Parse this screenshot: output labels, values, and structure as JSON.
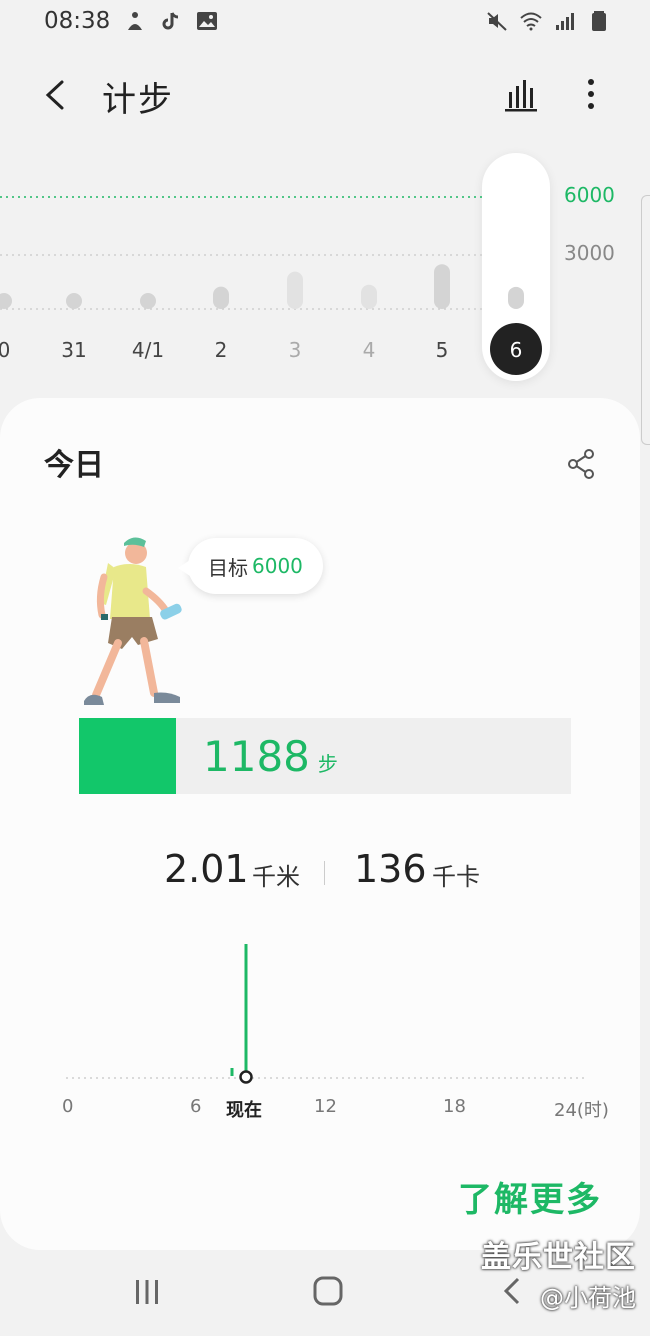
{
  "status_bar": {
    "time": "08:38",
    "icons_left": [
      "accessibility-icon",
      "tiktok-icon",
      "gallery-icon"
    ],
    "icons_right": [
      "mute-icon",
      "wifi-icon",
      "signal-icon",
      "battery-icon"
    ]
  },
  "app_bar": {
    "title": "计步",
    "back_icon": "chevron-left-icon",
    "chart_icon": "bar-chart-icon",
    "more_icon": "more-vertical-icon"
  },
  "week_chart": {
    "goal_label": "6000",
    "mid_label": "3000",
    "accent_color": "#1db865",
    "days": [
      {
        "label": "0",
        "steps": 150,
        "selected": false,
        "muted": false
      },
      {
        "label": "31",
        "steps": 150,
        "selected": false,
        "muted": false
      },
      {
        "label": "4/1",
        "steps": 150,
        "selected": false,
        "muted": false
      },
      {
        "label": "2",
        "steps": 1200,
        "selected": false,
        "muted": false
      },
      {
        "label": "3",
        "steps": 2000,
        "selected": false,
        "muted": true
      },
      {
        "label": "4",
        "steps": 1300,
        "selected": false,
        "muted": true
      },
      {
        "label": "5",
        "steps": 2400,
        "selected": false,
        "muted": false
      },
      {
        "label": "6",
        "steps": 1188,
        "selected": true,
        "muted": false
      }
    ]
  },
  "today_card": {
    "title": "今日",
    "share_icon": "share-icon",
    "goal_bubble": {
      "label": "目标",
      "value": "6000"
    },
    "steps": {
      "value": "1188",
      "unit": "步",
      "progress_fraction": 0.198
    },
    "distance": {
      "value": "2.01",
      "unit": "千米"
    },
    "calories": {
      "value": "136",
      "unit": "千卡"
    },
    "day_axis": {
      "labels": [
        "0",
        "6",
        "现在",
        "12",
        "18",
        "24(时)"
      ],
      "now_hour": 8.6
    },
    "learn_more": "了解更多"
  },
  "nav_bar": {
    "recent_icon": "recent-apps-icon",
    "home_icon": "home-icon",
    "back_icon": "back-icon"
  },
  "watermark": {
    "line1": "盖乐世社区",
    "line2": "@小荷池"
  }
}
